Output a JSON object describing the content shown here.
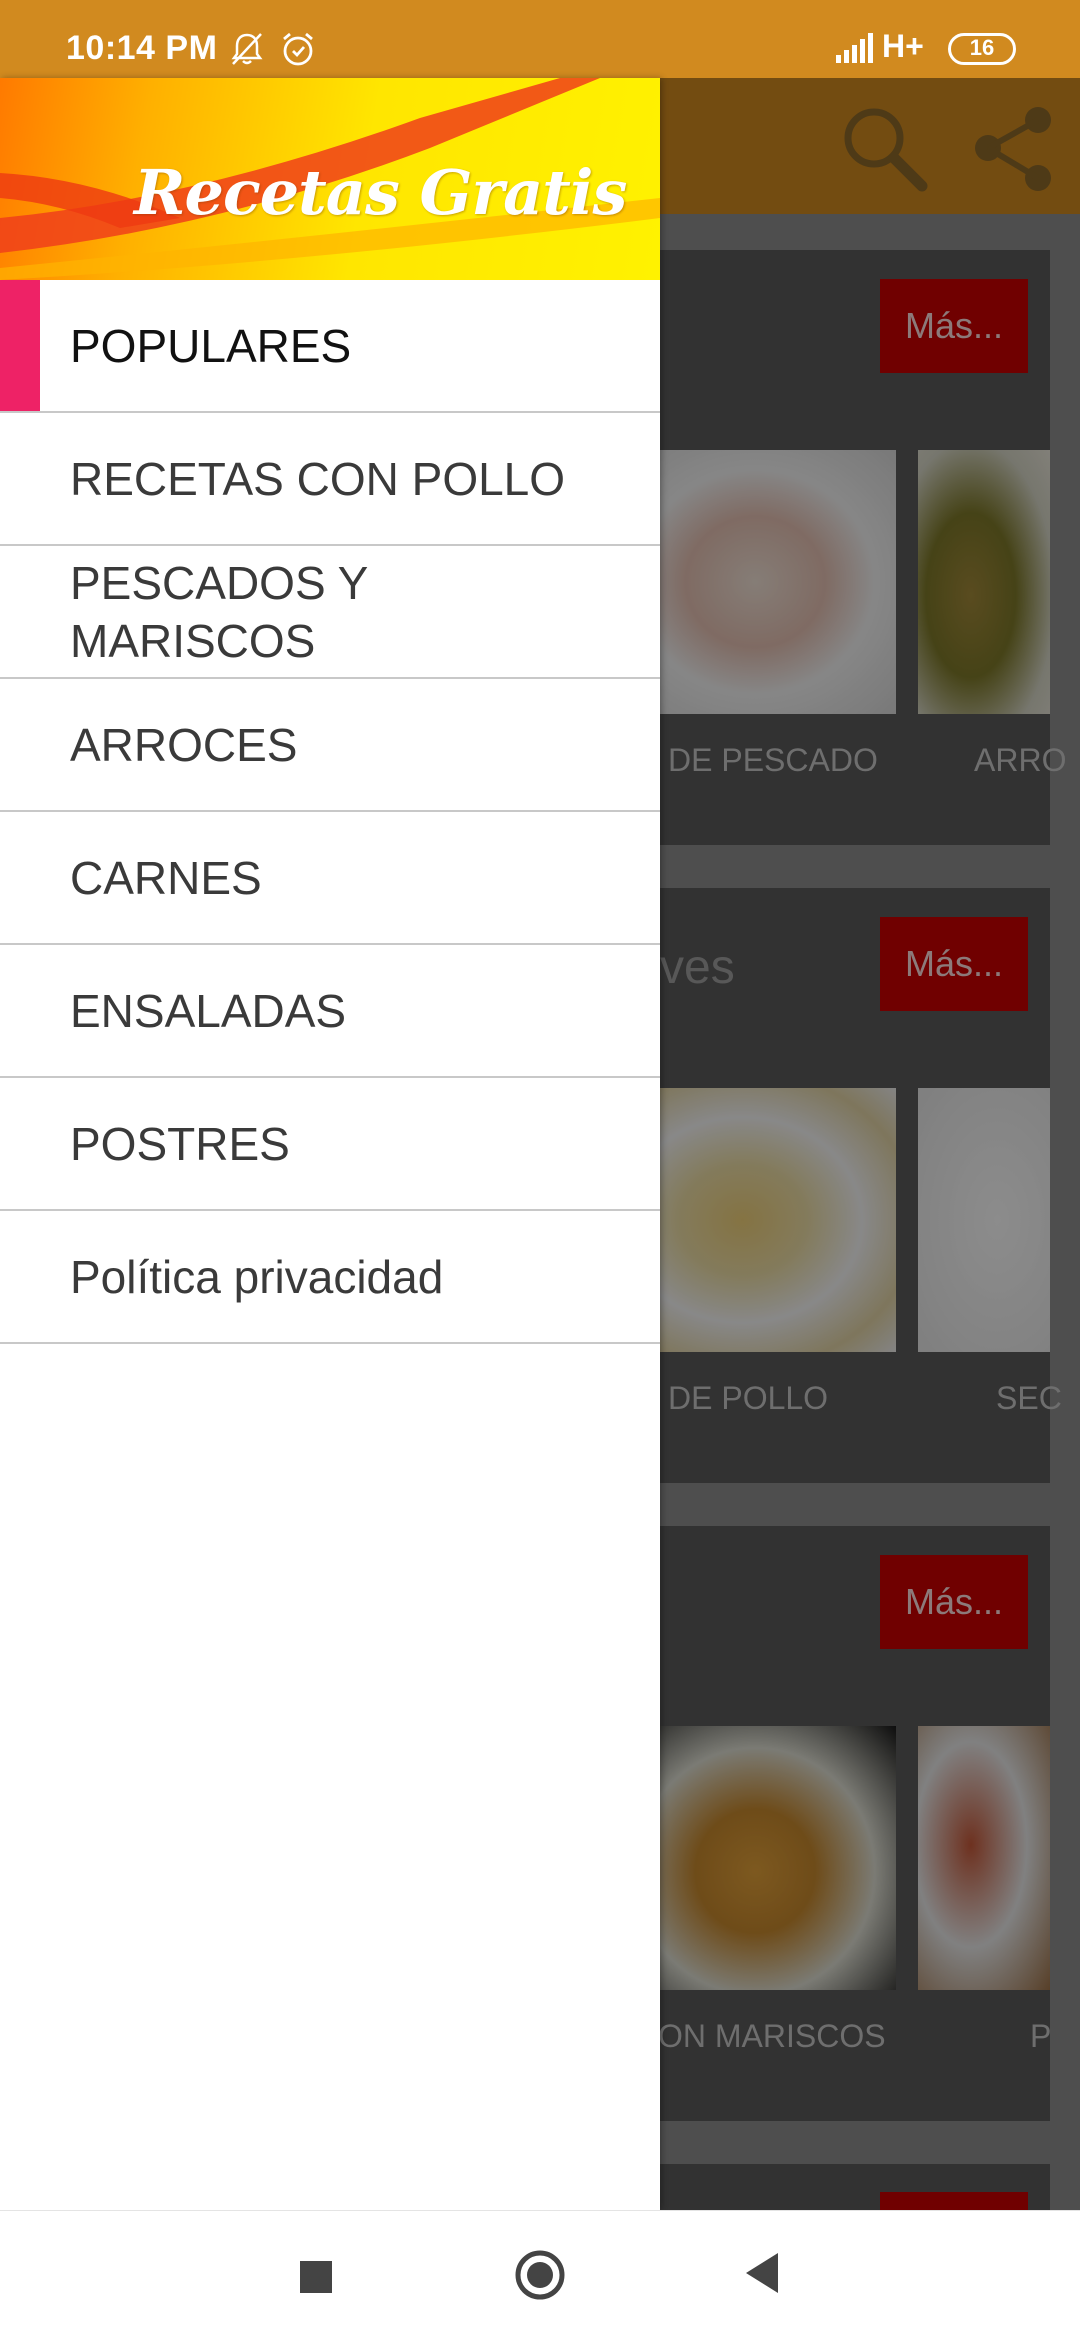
{
  "status_bar": {
    "time": "10:14 PM",
    "network": "H+",
    "battery": "16"
  },
  "drawer": {
    "header_title": "Recetas Gratis",
    "items": [
      {
        "label": "POPULARES",
        "active": true
      },
      {
        "label": "RECETAS CON POLLO",
        "active": false
      },
      {
        "label": "PESCADOS Y MARISCOS",
        "active": false
      },
      {
        "label": "ARROCES",
        "active": false
      },
      {
        "label": "CARNES",
        "active": false
      },
      {
        "label": "ENSALADAS",
        "active": false
      },
      {
        "label": "POSTRES",
        "active": false
      },
      {
        "label": "Política privacidad",
        "active": false
      }
    ]
  },
  "background": {
    "sections": [
      {
        "title": "",
        "more_label": "Más...",
        "captions": [
          "DE PESCADO",
          "ARRO"
        ]
      },
      {
        "title": "ves",
        "more_label": "Más...",
        "captions": [
          "DE POLLO",
          "SEC"
        ]
      },
      {
        "title": "",
        "more_label": "Más...",
        "captions": [
          "ON MARISCOS",
          "P"
        ]
      }
    ]
  },
  "icons": {
    "search": "search-icon",
    "share": "share-icon",
    "bell": "bell-off-icon",
    "alarm": "alarm-icon"
  },
  "colors": {
    "toolbar": "#d18a1f",
    "accent": "#ee2266",
    "more_button": "#cc0000"
  }
}
